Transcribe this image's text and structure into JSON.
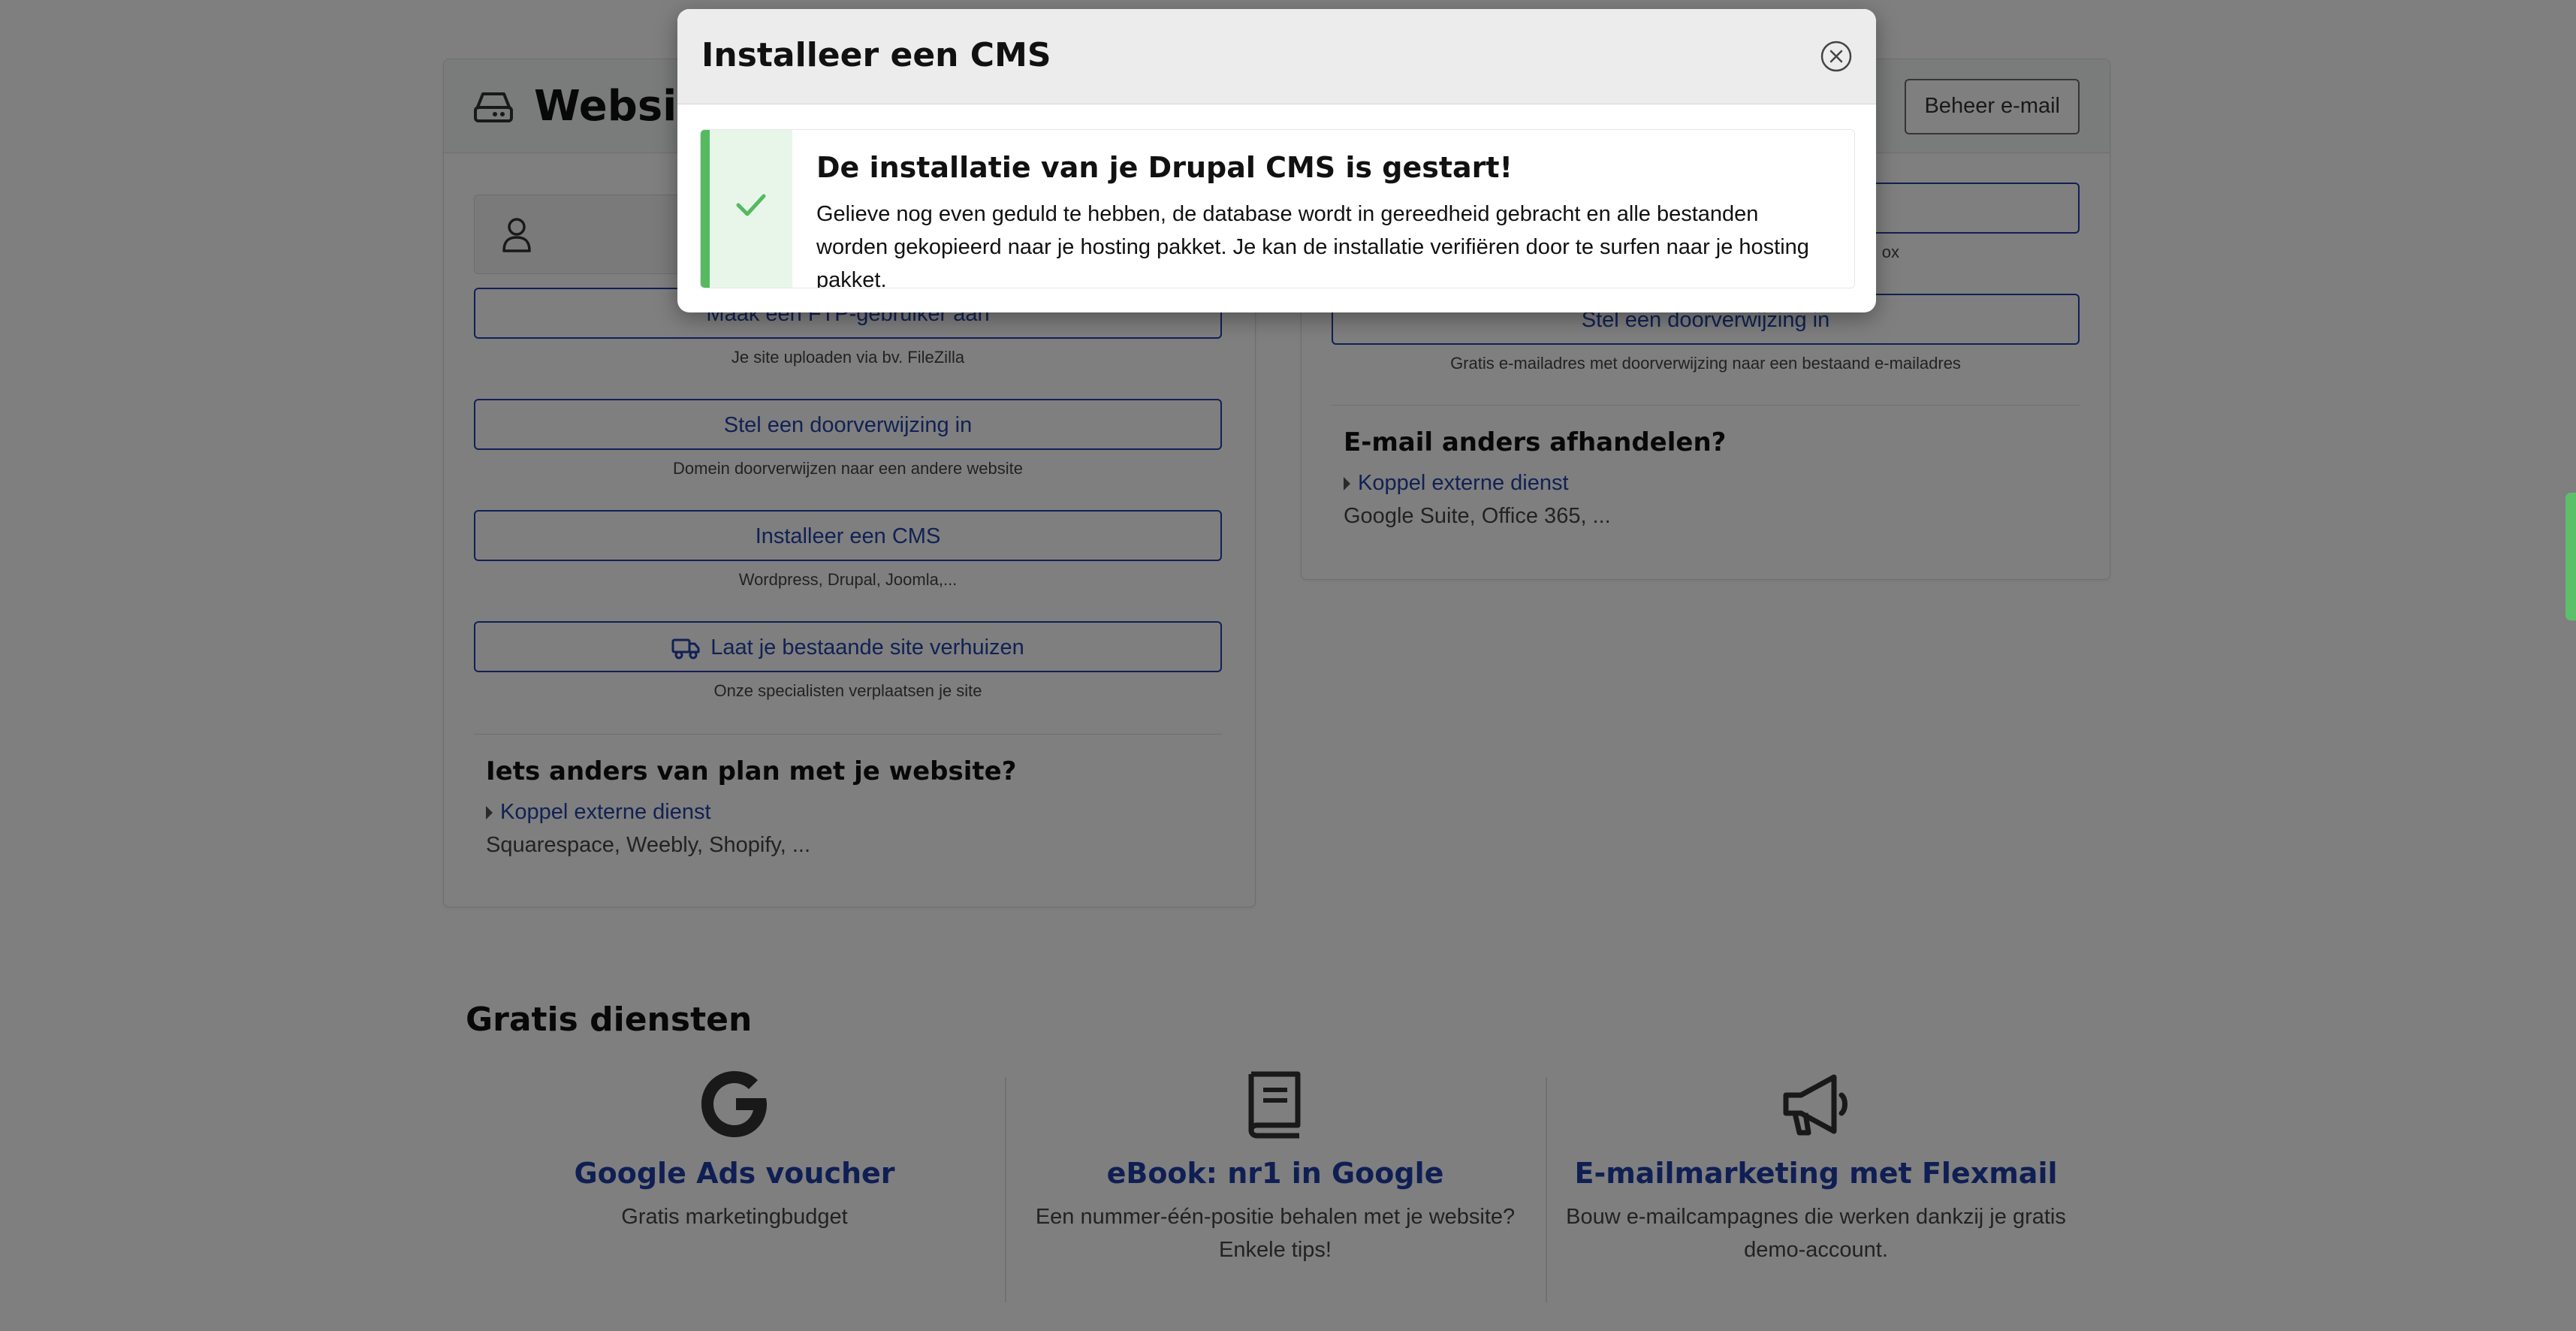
{
  "website_card": {
    "title": "Website",
    "ftp": {
      "label": "Maak een FTP-gebruiker aan",
      "sub": "Je site uploaden via bv. FileZilla"
    },
    "redirect": {
      "label": "Stel een doorverwijzing in",
      "sub": "Domein doorverwijzen naar een andere website"
    },
    "cms": {
      "label": "Installeer een CMS",
      "sub": "Wordpress, Drupal, Joomla,..."
    },
    "move": {
      "label": "Laat je bestaande site verhuizen",
      "sub": "Onze specialisten verplaatsen je site"
    },
    "other": {
      "title": "Iets anders van plan met je website?",
      "link": "Koppel externe dienst",
      "desc": "Squarespace, Weebly, Shopify, ..."
    }
  },
  "email_card": {
    "manage_button": "Beheer e-mail",
    "partial_sub": "ox",
    "redirect": {
      "label": "Stel een doorverwijzing in",
      "sub": "Gratis e-mailadres met doorverwijzing naar een bestaand e-mailadres"
    },
    "other": {
      "title": "E-mail anders afhandelen?",
      "link": "Koppel externe dienst",
      "desc": "Google Suite, Office 365, ..."
    }
  },
  "free_services": {
    "title": "Gratis diensten",
    "items": [
      {
        "icon": "google-icon",
        "title": "Google Ads voucher",
        "desc": "Gratis marketingbudget"
      },
      {
        "icon": "book-icon",
        "title": "eBook: nr1 in Google",
        "desc": "Een nummer-één-positie behalen met je website? Enkele tips!"
      },
      {
        "icon": "megaphone-icon",
        "title": "E-mailmarketing met Flexmail",
        "desc": "Bouw e-mailcampagnes die werken dankzij je gratis demo-account."
      }
    ]
  },
  "modal": {
    "title": "Installeer een CMS",
    "alert_title": "De installatie van je Drupal CMS is gestart!",
    "alert_text": "Gelieve nog even geduld te hebben, de database wordt in gereedheid gebracht en alle bestanden worden gekopieerd naar je hosting pakket. Je kan de installatie verifiëren door te surfen naar je hosting pakket."
  },
  "colors": {
    "link": "#2342a8",
    "success": "#55b960",
    "overlay": "rgba(0,0,0,0.5)"
  }
}
